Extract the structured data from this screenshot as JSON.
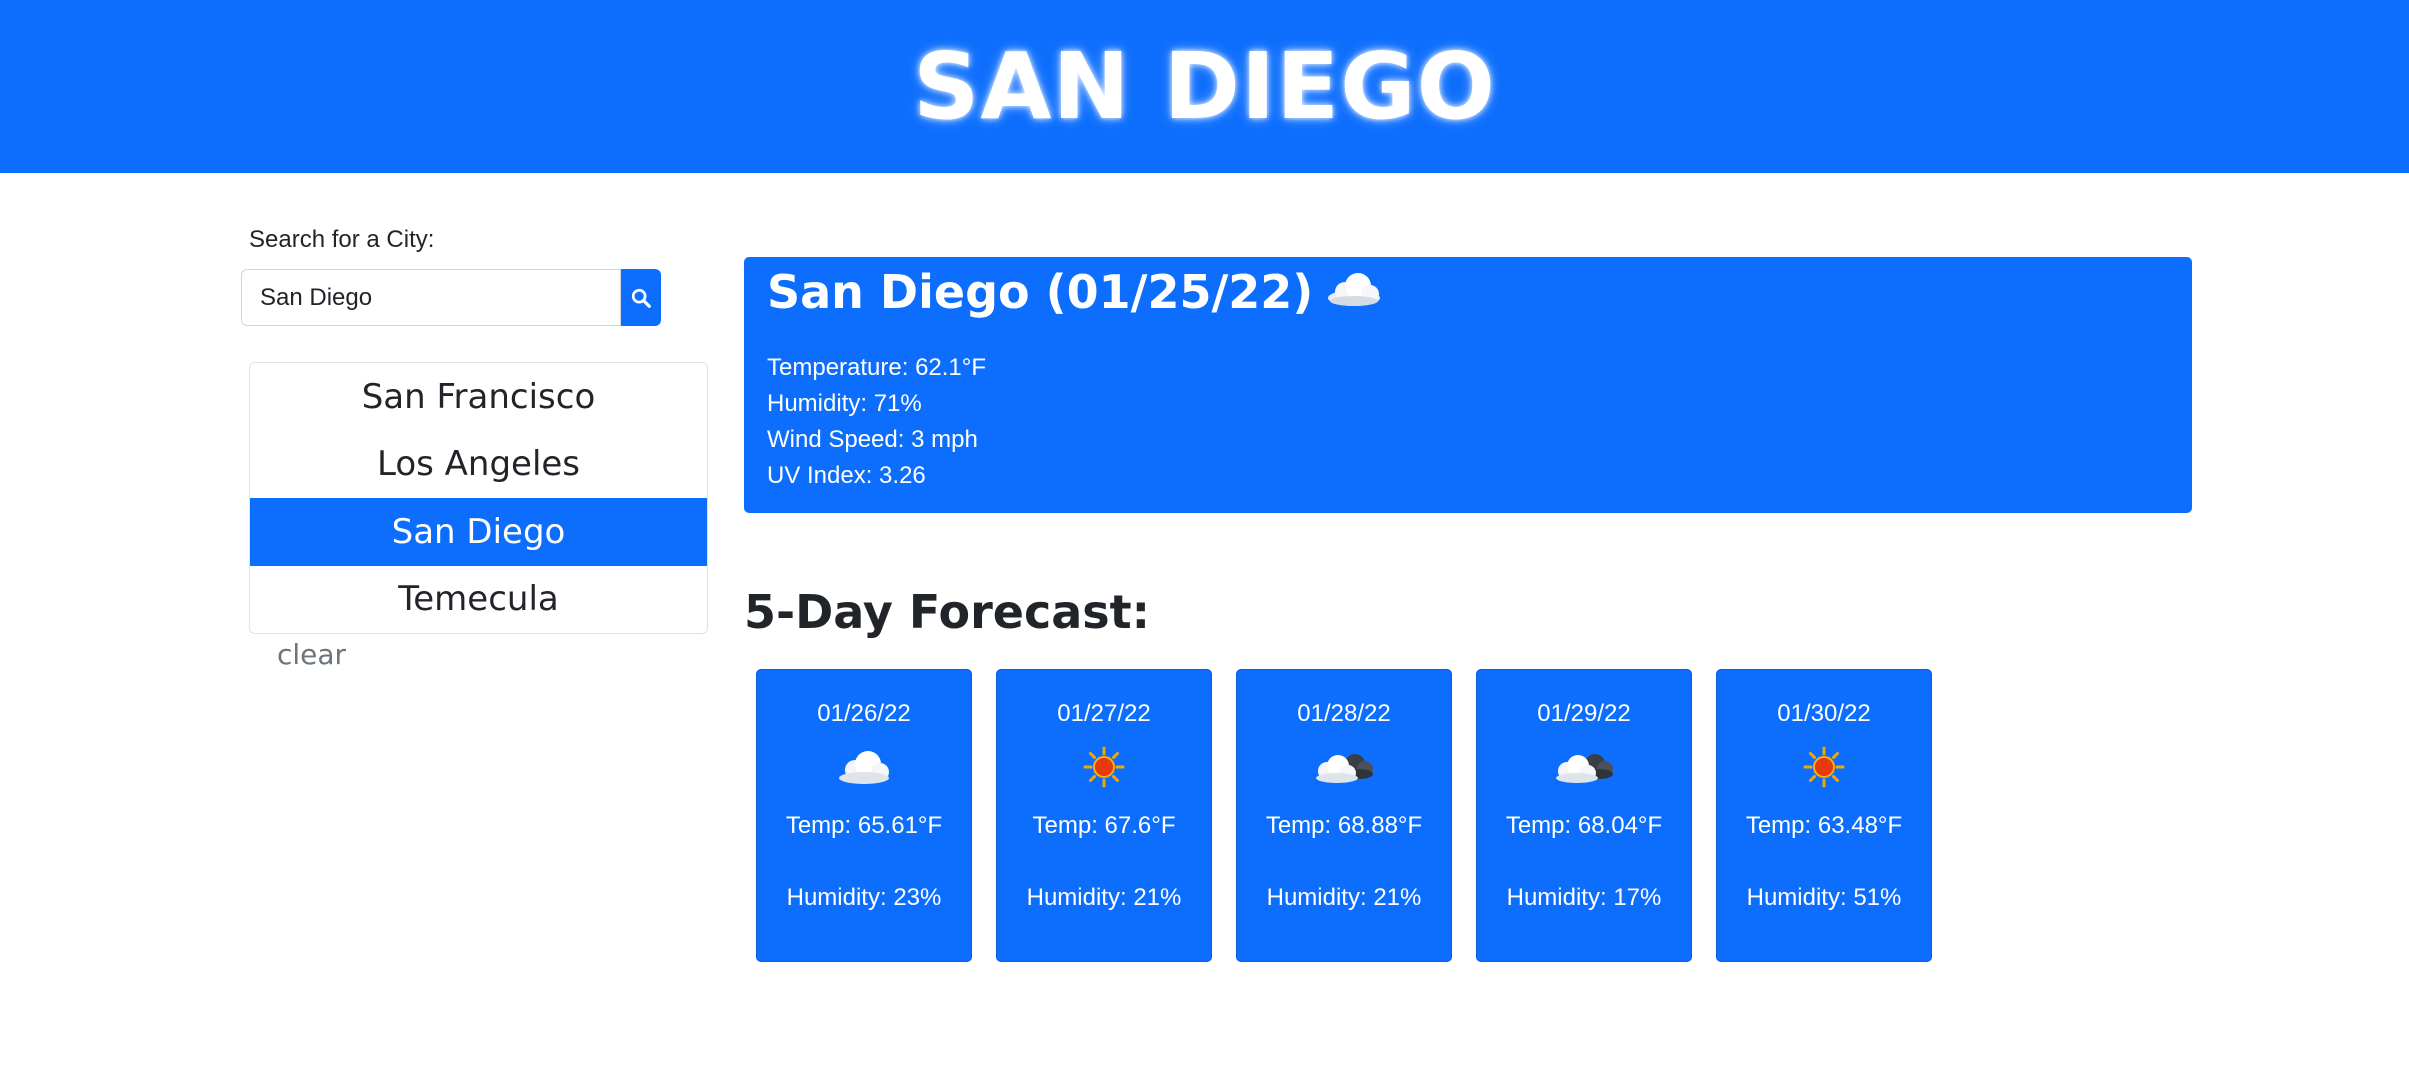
{
  "header": {
    "title": "SAN DIEGO"
  },
  "search": {
    "label": "Search for a City:",
    "value": "San Diego",
    "button_icon": "search-icon"
  },
  "history": {
    "items": [
      {
        "label": "San Francisco",
        "active": false
      },
      {
        "label": "Los Angeles",
        "active": false
      },
      {
        "label": "San Diego",
        "active": true
      },
      {
        "label": "Temecula",
        "active": false
      }
    ],
    "clear_label": "clear"
  },
  "current": {
    "title": "San Diego (01/25/22)",
    "icon": "cloud-icon",
    "temperature": "Temperature: 62.1°F",
    "humidity": "Humidity: 71%",
    "wind": "Wind Speed: 3 mph",
    "uv": "UV Index: 3.26"
  },
  "forecast": {
    "heading": "5-Day Forecast:",
    "days": [
      {
        "date": "01/26/22",
        "icon": "cloud-icon",
        "temp": "Temp: 65.61°F",
        "humidity": "Humidity: 23%"
      },
      {
        "date": "01/27/22",
        "icon": "sun-icon",
        "temp": "Temp: 67.6°F",
        "humidity": "Humidity: 21%"
      },
      {
        "date": "01/28/22",
        "icon": "partly-cloudy-icon",
        "temp": "Temp: 68.88°F",
        "humidity": "Humidity: 21%"
      },
      {
        "date": "01/29/22",
        "icon": "partly-cloudy-icon",
        "temp": "Temp: 68.04°F",
        "humidity": "Humidity: 17%"
      },
      {
        "date": "01/30/22",
        "icon": "sun-icon",
        "temp": "Temp: 63.48°F",
        "humidity": "Humidity: 51%"
      }
    ]
  },
  "colors": {
    "primary": "#0d6efd",
    "text": "#212529",
    "muted": "#6c757d"
  }
}
